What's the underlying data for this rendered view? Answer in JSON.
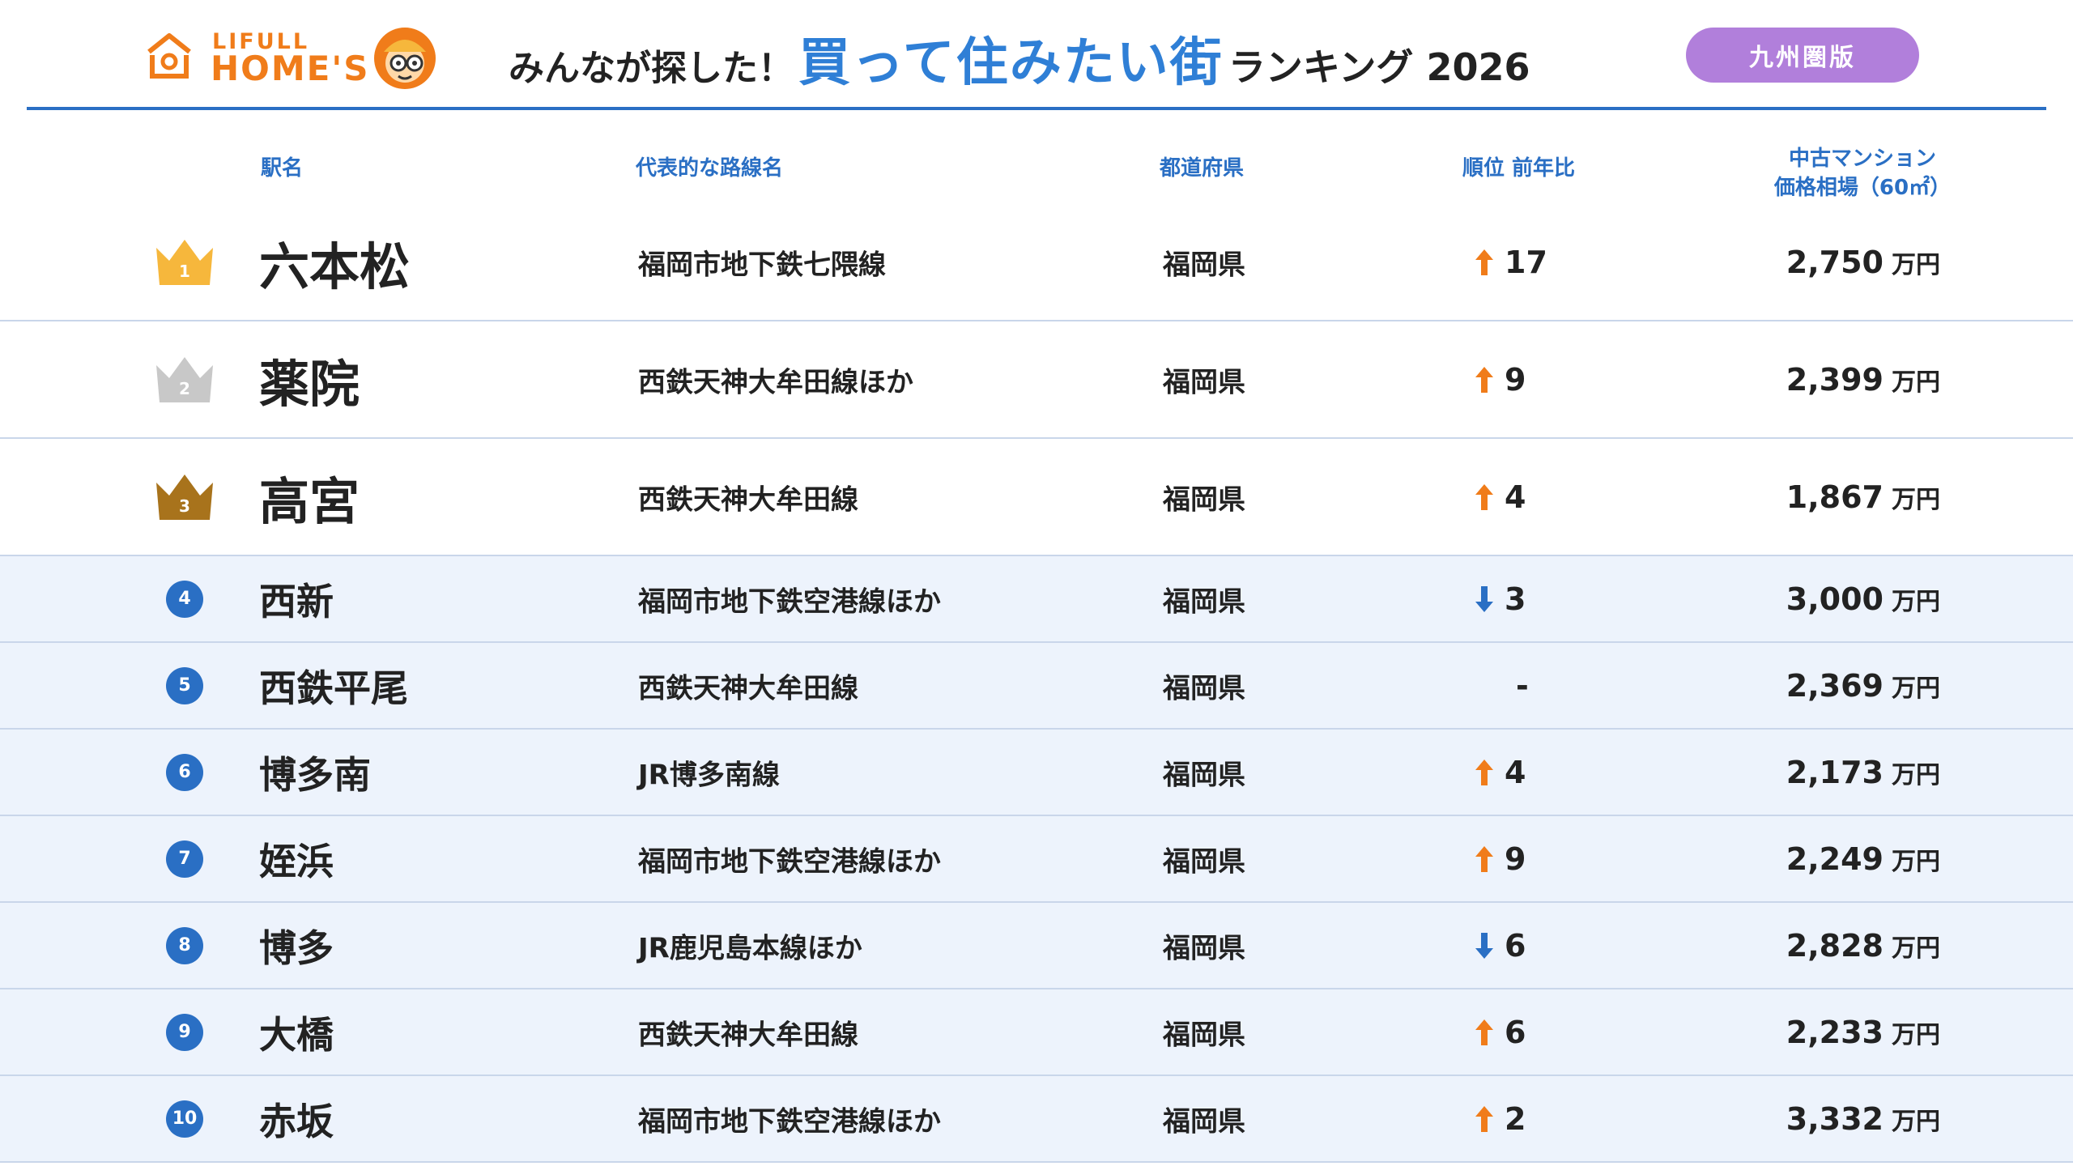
{
  "header": {
    "logo_small": "LIFULL",
    "logo_big": "HOME'S",
    "title_pre": "みんなが探した！",
    "title_main": "買って住みたい街",
    "title_post": "ランキング 2026",
    "region_badge": "九州圏版"
  },
  "columns": {
    "station": "駅名",
    "line": "代表的な路線名",
    "prefecture": "都道府県",
    "rank_change": "順位 前年比",
    "price_line1": "中古マンション",
    "price_line2": "価格相場（60㎡）"
  },
  "colors": {
    "accent_blue": "#2a6fc4",
    "title_blue": "#2f7fd6",
    "up_orange": "#f07c1a",
    "down_blue": "#2a6fc4",
    "badge_purple": "#b17fdb",
    "gold": "#f6b73c",
    "silver": "#c8c8c8",
    "bronze": "#a8731c"
  },
  "price_unit": "万円",
  "rows": [
    {
      "rank": "1",
      "icon": "gold-crown-icon",
      "station": "六本松",
      "line": "福岡市地下鉄七隈線",
      "prefecture": "福岡県",
      "direction": "up",
      "change": "17",
      "price": "2,750"
    },
    {
      "rank": "2",
      "icon": "silver-crown-icon",
      "station": "薬院",
      "line": "西鉄天神大牟田線ほか",
      "prefecture": "福岡県",
      "direction": "up",
      "change": "9",
      "price": "2,399"
    },
    {
      "rank": "3",
      "icon": "bronze-crown-icon",
      "station": "高宮",
      "line": "西鉄天神大牟田線",
      "prefecture": "福岡県",
      "direction": "up",
      "change": "4",
      "price": "1,867"
    },
    {
      "rank": "4",
      "icon": "rank-circle-icon",
      "station": "西新",
      "line": "福岡市地下鉄空港線ほか",
      "prefecture": "福岡県",
      "direction": "down",
      "change": "3",
      "price": "3,000"
    },
    {
      "rank": "5",
      "icon": "rank-circle-icon",
      "station": "西鉄平尾",
      "line": "西鉄天神大牟田線",
      "prefecture": "福岡県",
      "direction": "flat",
      "change": "-",
      "price": "2,369"
    },
    {
      "rank": "6",
      "icon": "rank-circle-icon",
      "station": "博多南",
      "line": "JR博多南線",
      "prefecture": "福岡県",
      "direction": "up",
      "change": "4",
      "price": "2,173"
    },
    {
      "rank": "7",
      "icon": "rank-circle-icon",
      "station": "姪浜",
      "line": "福岡市地下鉄空港線ほか",
      "prefecture": "福岡県",
      "direction": "up",
      "change": "9",
      "price": "2,249"
    },
    {
      "rank": "8",
      "icon": "rank-circle-icon",
      "station": "博多",
      "line": "JR鹿児島本線ほか",
      "prefecture": "福岡県",
      "direction": "down",
      "change": "6",
      "price": "2,828"
    },
    {
      "rank": "9",
      "icon": "rank-circle-icon",
      "station": "大橋",
      "line": "西鉄天神大牟田線",
      "prefecture": "福岡県",
      "direction": "up",
      "change": "6",
      "price": "2,233"
    },
    {
      "rank": "10",
      "icon": "rank-circle-icon",
      "station": "赤坂",
      "line": "福岡市地下鉄空港線ほか",
      "prefecture": "福岡県",
      "direction": "up",
      "change": "2",
      "price": "3,332"
    }
  ]
}
